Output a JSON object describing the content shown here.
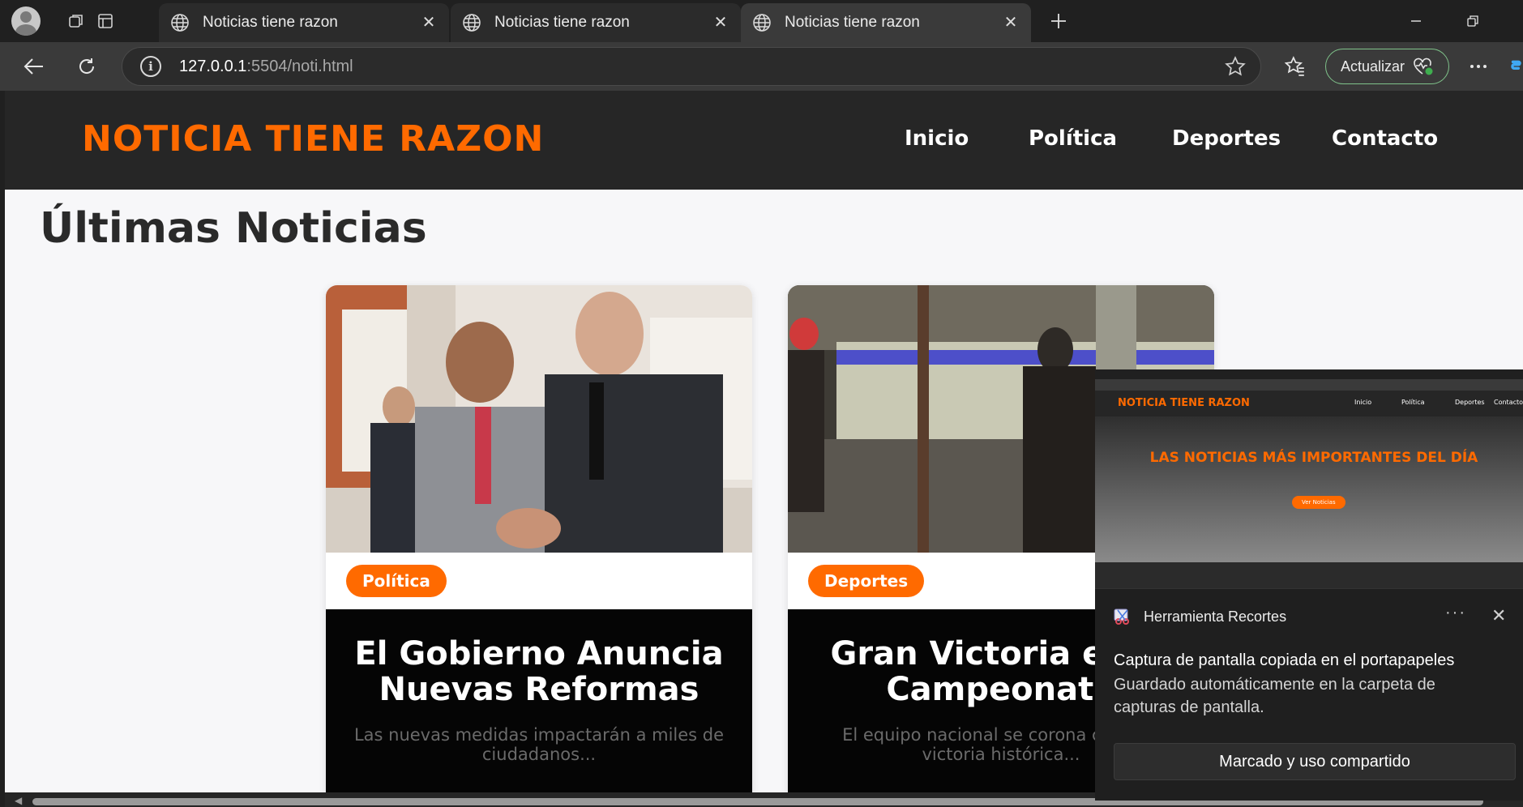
{
  "browser": {
    "tabs": [
      {
        "title": "Noticias tiene razon",
        "active": false
      },
      {
        "title": "Noticias tiene razon",
        "active": false
      },
      {
        "title": "Noticias tiene razon",
        "active": true
      }
    ],
    "url_host": "127.0.0.1",
    "url_path": ":5504/noti.html",
    "update_label": "Actualizar"
  },
  "site": {
    "brand": "NOTICIA TIENE RAZON",
    "nav": [
      "Inicio",
      "Política",
      "Deportes",
      "Contacto"
    ],
    "section_title": "Últimas Noticias",
    "accent_color": "#ff6a00",
    "articles": [
      {
        "category": "Política",
        "headline": "El Gobierno Anuncia\nNuevas Reformas",
        "excerpt": "Las nuevas medidas impactarán a miles de\nciudadanos..."
      },
      {
        "category": "Deportes",
        "headline": "Gran Victoria en el\nCampeonato",
        "excerpt": "El equipo nacional se corona con una\nvictoria histórica..."
      }
    ]
  },
  "snip_preview": {
    "brand": "NOTICIA TIENE RAZON",
    "nav": [
      "Inicio",
      "Política",
      "Deportes",
      "Contacto"
    ],
    "hero_title": "LAS NOTICIAS MÁS IMPORTANTES DEL DÍA",
    "hero_button": "Ver Noticias"
  },
  "notification": {
    "app_name": "Herramienta Recortes",
    "title": "Captura de pantalla copiada en el portapapeles",
    "body": "Guardado automáticamente en la carpeta de capturas de pantalla.",
    "action": "Marcado y uso compartido"
  }
}
